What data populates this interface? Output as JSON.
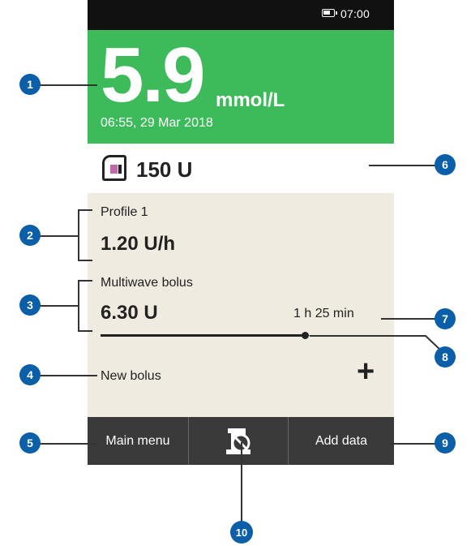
{
  "status_bar": {
    "time": "07:00"
  },
  "bg": {
    "value": "5.9",
    "unit": "mmol/L",
    "timestamp": "06:55, 29 Mar 2018"
  },
  "reservoir": {
    "amount": "150 U"
  },
  "basal": {
    "profile": "Profile 1",
    "rate": "1.20 U/h"
  },
  "bolus": {
    "type": "Multiwave bolus",
    "amount": "6.30 U",
    "remaining": "1 h 25 min",
    "progress": 0.73
  },
  "new_bolus": {
    "label": "New bolus",
    "add_symbol": "+"
  },
  "softkeys": {
    "left": "Main menu",
    "middle_icon": "stop-pump-icon",
    "right": "Add data"
  },
  "callouts": [
    "1",
    "2",
    "3",
    "4",
    "5",
    "6",
    "7",
    "8",
    "9",
    "10"
  ],
  "colors": {
    "bg_panel": "#3dba5a",
    "badge": "#0a5fa8",
    "softkey_bar": "#3a3a3a",
    "reservoir_fill": "#c06aa6"
  }
}
